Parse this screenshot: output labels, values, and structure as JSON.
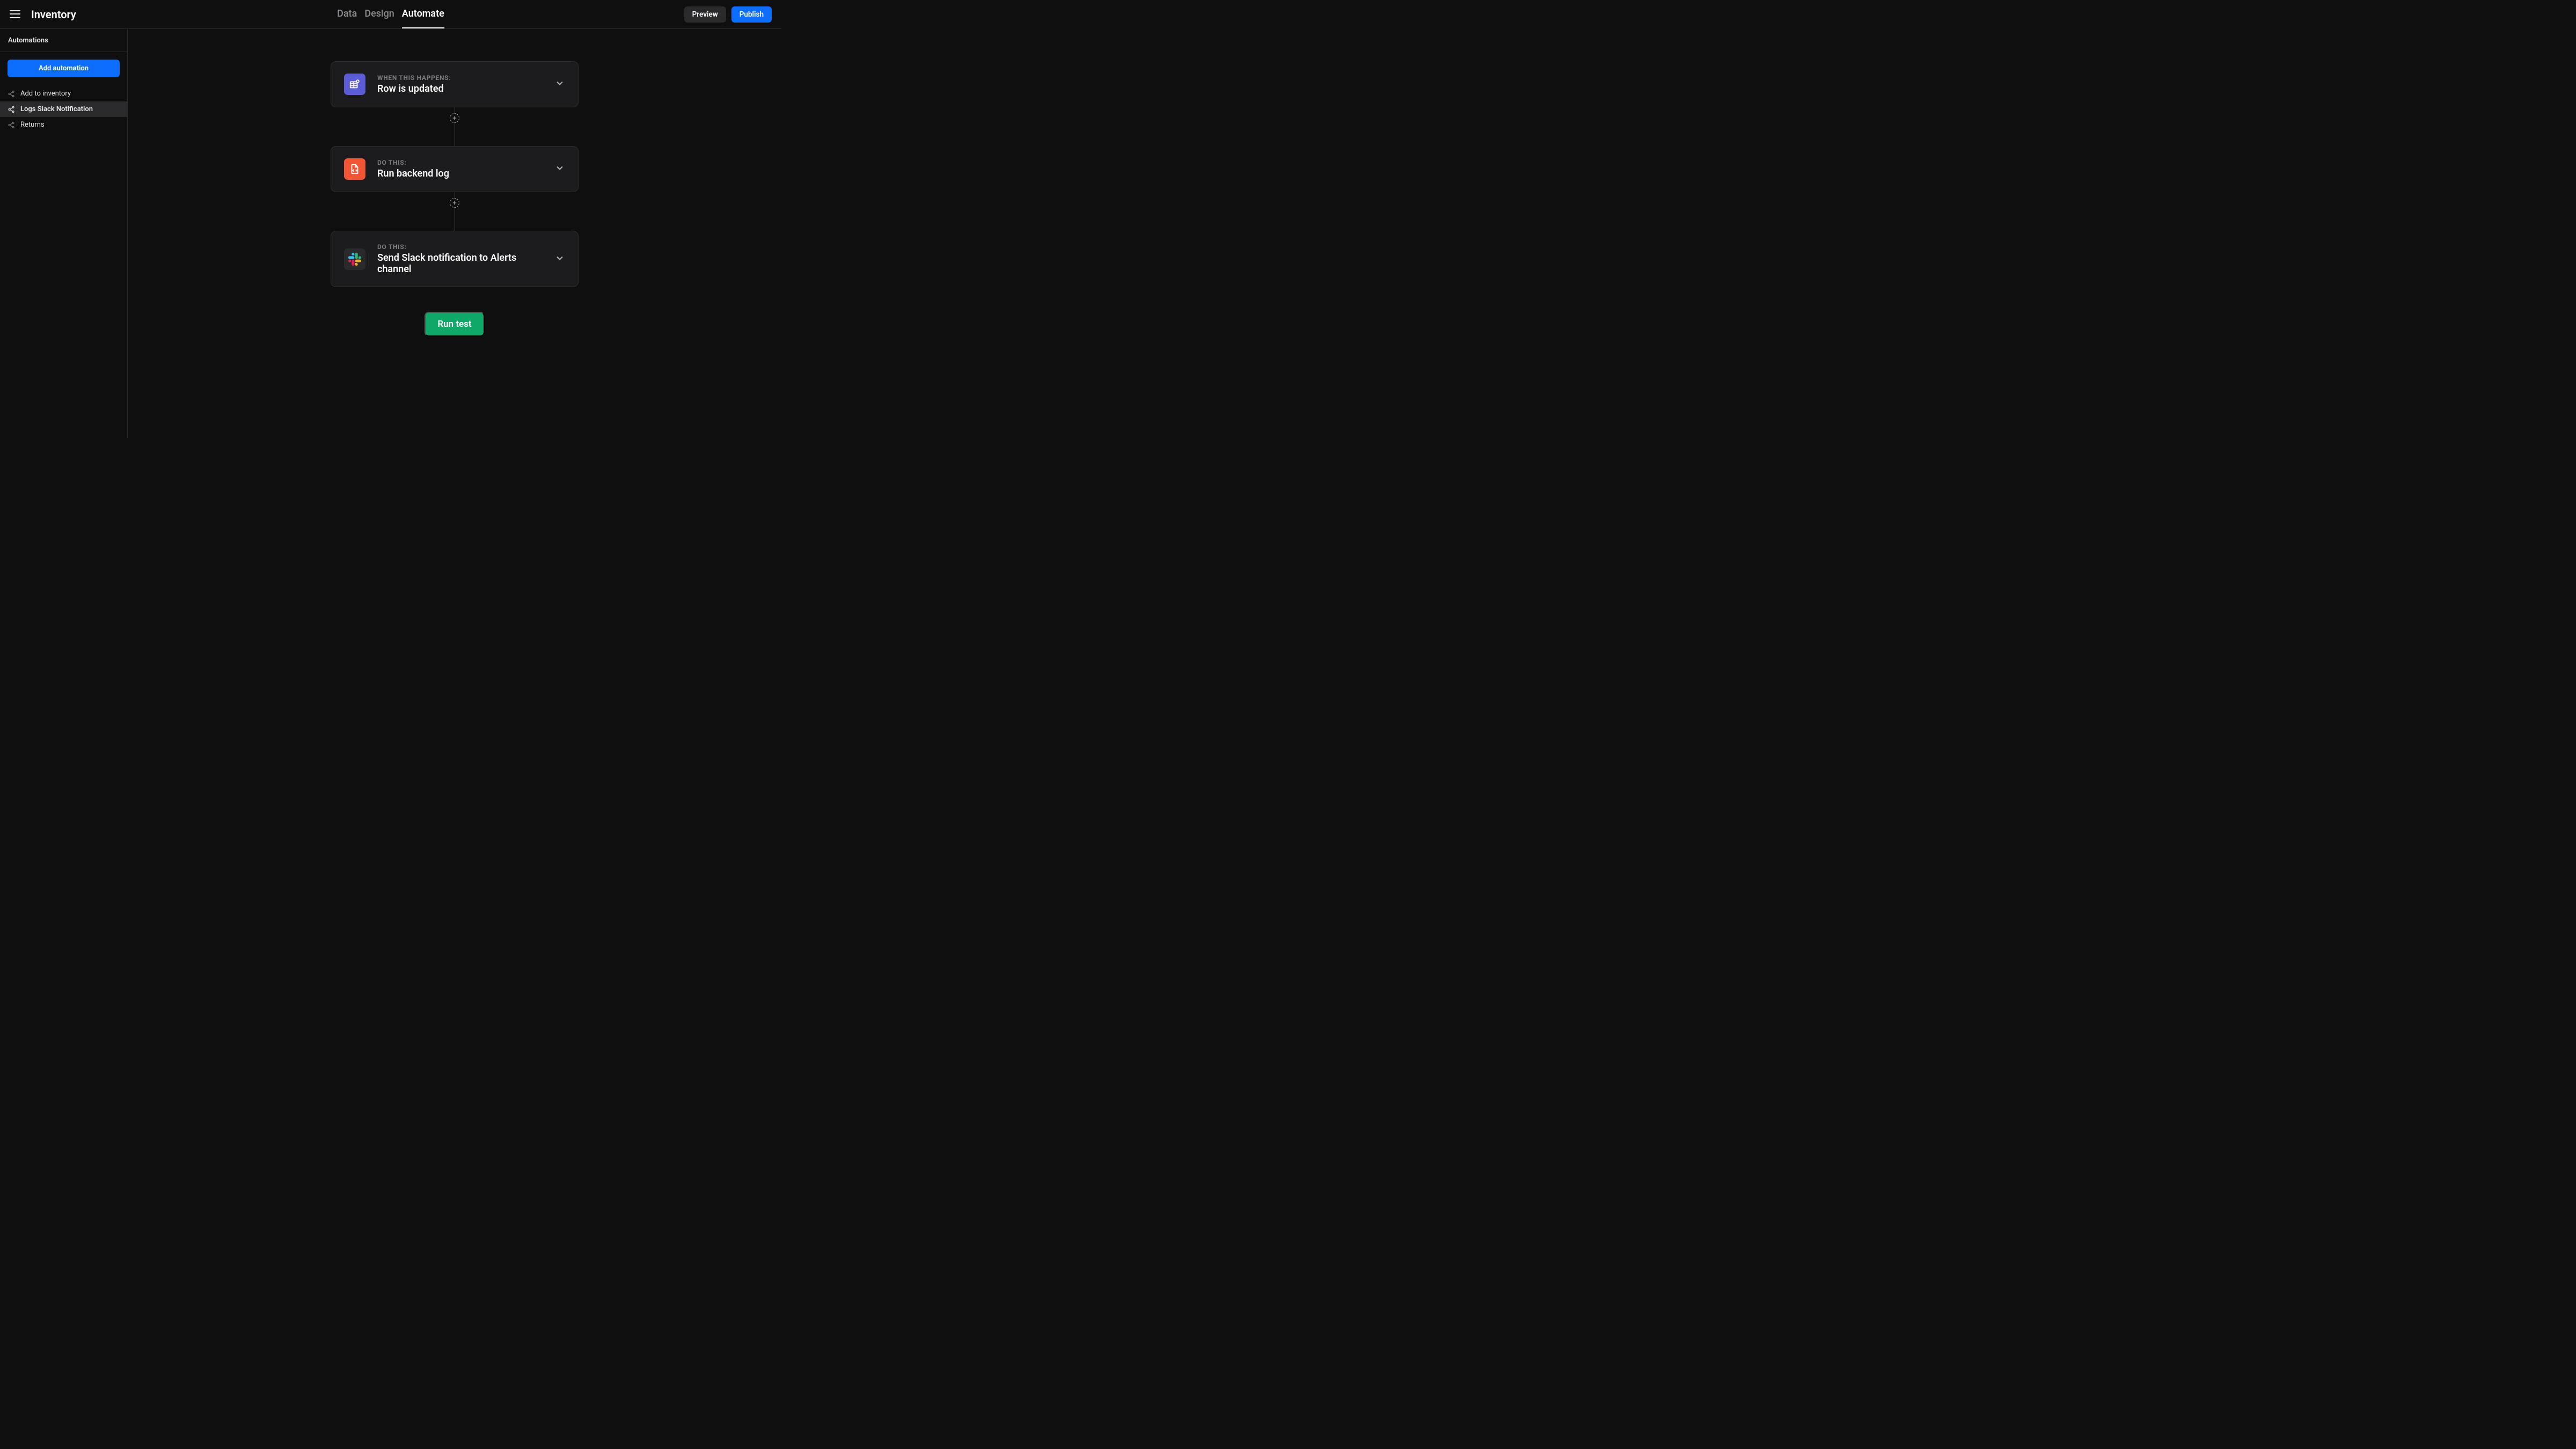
{
  "header": {
    "title": "Inventory",
    "tabs": [
      {
        "label": "Data",
        "active": false
      },
      {
        "label": "Design",
        "active": false
      },
      {
        "label": "Automate",
        "active": true
      }
    ],
    "preview_label": "Preview",
    "publish_label": "Publish"
  },
  "sidebar": {
    "header": "Automations",
    "add_button": "Add automation",
    "items": [
      {
        "label": "Add to inventory",
        "selected": false
      },
      {
        "label": "Logs Slack Notification",
        "selected": true
      },
      {
        "label": "Returns",
        "selected": false
      }
    ]
  },
  "flow": {
    "steps": [
      {
        "label": "WHEN THIS HAPPENS:",
        "title": "Row is updated",
        "icon": "table-plus",
        "color": "purple"
      },
      {
        "label": "DO THIS:",
        "title": "Run backend log",
        "icon": "code-file",
        "color": "orange"
      },
      {
        "label": "DO THIS:",
        "title": "Send Slack notification to Alerts channel",
        "icon": "slack",
        "color": "dark"
      }
    ],
    "run_test_label": "Run test"
  }
}
